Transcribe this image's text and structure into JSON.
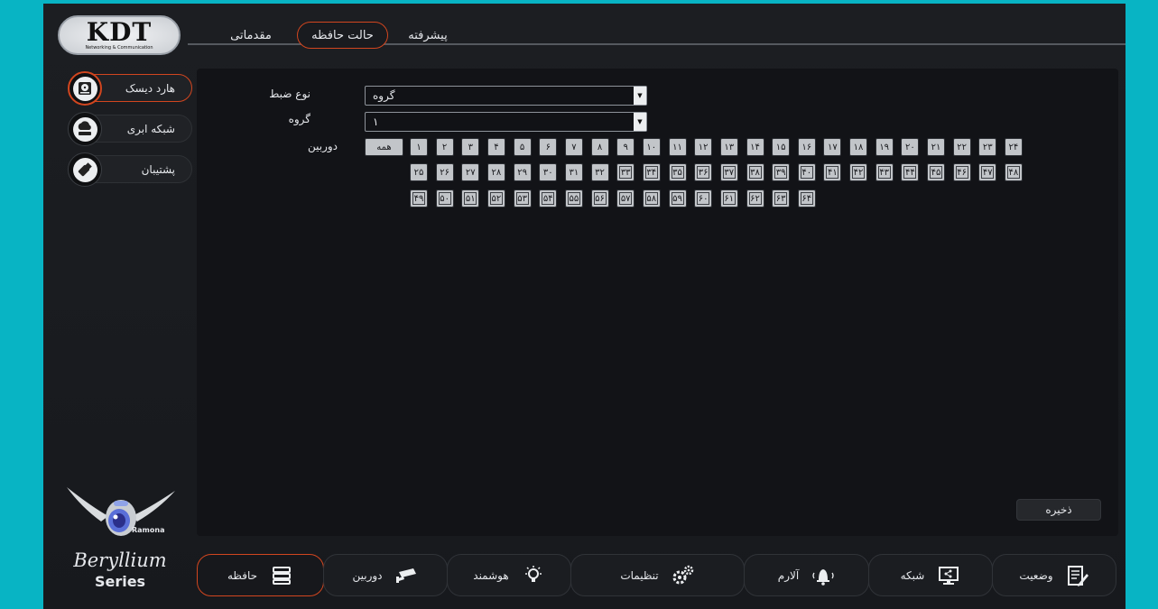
{
  "logo": {
    "main": "KDT",
    "sub": "Networking & Communication"
  },
  "top_tabs": {
    "basic": "مقدماتی",
    "storage_mode": "حالت حافظه",
    "advanced": "پیشرفته"
  },
  "side_menu": [
    {
      "label": "هارد دیسک",
      "icon": "hard-disk-icon"
    },
    {
      "label": "شبکه ابری",
      "icon": "cloud-network-icon"
    },
    {
      "label": "پشتیبان",
      "icon": "usb-backup-icon"
    }
  ],
  "form": {
    "record_type_label": "نوع ضبط",
    "record_type_value": "گروه",
    "group_label": "گروه",
    "group_value": "۱",
    "camera_label": "دوربین",
    "all_label": "همه"
  },
  "channels": [
    "۱",
    "۲",
    "۳",
    "۴",
    "۵",
    "۶",
    "۷",
    "۸",
    "۹",
    "۱۰",
    "۱۱",
    "۱۲",
    "۱۳",
    "۱۴",
    "۱۵",
    "۱۶",
    "۱۷",
    "۱۸",
    "۱۹",
    "۲۰",
    "۲۱",
    "۲۲",
    "۲۳",
    "۲۴",
    "۲۵",
    "۲۶",
    "۲۷",
    "۲۸",
    "۲۹",
    "۳۰",
    "۳۱",
    "۳۲",
    "۳۳",
    "۳۴",
    "۳۵",
    "۳۶",
    "۳۷",
    "۳۸",
    "۳۹",
    "۴۰",
    "۴۱",
    "۴۲",
    "۴۳",
    "۴۴",
    "۴۵",
    "۴۶",
    "۴۷",
    "۴۸",
    "۴۹",
    "۵۰",
    "۵۱",
    "۵۲",
    "۵۳",
    "۵۴",
    "۵۵",
    "۵۶",
    "۵۷",
    "۵۸",
    "۵۹",
    "۶۰",
    "۶۱",
    "۶۲",
    "۶۳",
    "۶۴"
  ],
  "save_label": "ذخیره",
  "brand": {
    "name": "Beryllium",
    "series": "Series",
    "mascot": "Ramona"
  },
  "bottom_nav": [
    {
      "label": "حافظه",
      "icon": "storage-icon"
    },
    {
      "label": "دوربین",
      "icon": "camera-icon"
    },
    {
      "label": "هوشمند",
      "icon": "smart-icon"
    },
    {
      "label": "تنظیمات",
      "icon": "gears-icon"
    },
    {
      "label": "آلارم",
      "icon": "alarm-bell-icon"
    },
    {
      "label": "شبکه",
      "icon": "network-monitor-icon"
    },
    {
      "label": "وضعیت",
      "icon": "status-notepad-icon"
    }
  ],
  "colors": {
    "accent": "#d2461f",
    "frame": "#08b4c4",
    "background": "#1b1d21",
    "panel": "#121317"
  }
}
